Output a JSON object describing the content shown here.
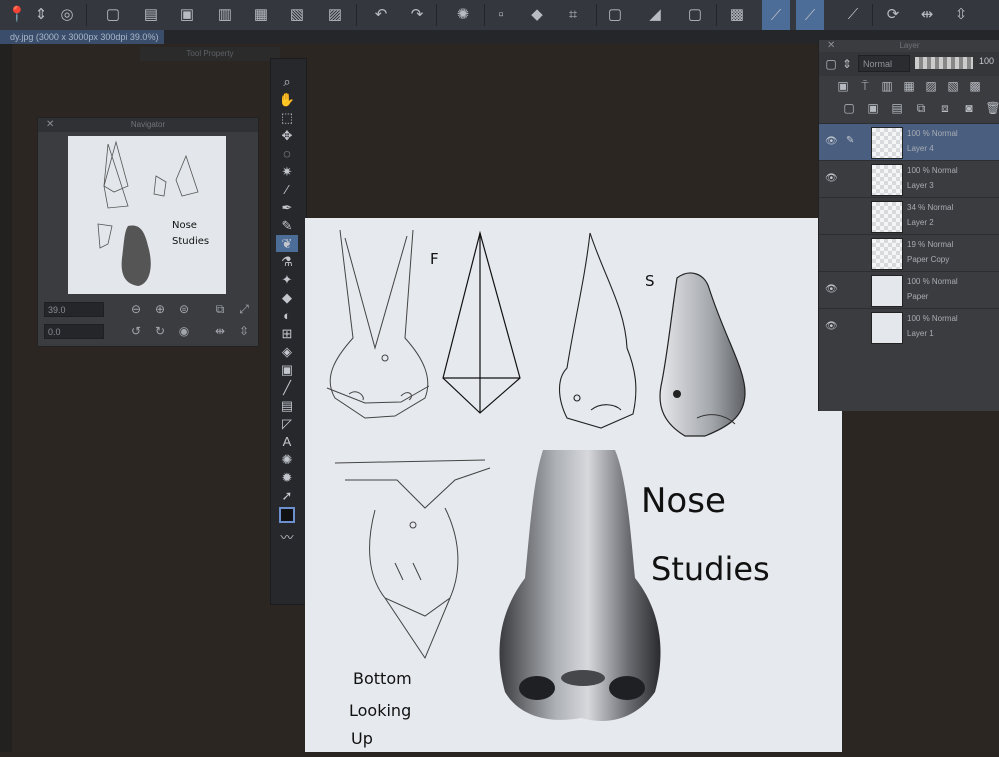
{
  "document": {
    "tab_label": "dy.jpg (3000 x 3000px 300dpi 39.0%)"
  },
  "toolbar": {
    "icons": [
      "pin-icon",
      "updown-icon",
      "app-icon",
      "new-file-icon",
      "open-folder-icon",
      "save-icon",
      "save-as-icon",
      "export-icon",
      "print-icon",
      "undo-icon",
      "redo-icon",
      "loading-icon",
      "fill-icon",
      "crop-icon",
      "clear-icon",
      "tone-icon",
      "transparency-icon",
      "grid-icon",
      "ruler-snap-icon",
      "line-snap-icon",
      "ruler-icon",
      "rotate-icon",
      "flip-horizontal-icon",
      "flip-vertical-icon"
    ]
  },
  "navigator": {
    "title": "Navigator",
    "zoom_value": "39.0",
    "rotation_value": "0.0"
  },
  "tool_property": {
    "title": "Tool Property"
  },
  "layer_panel": {
    "title": "Layer",
    "blend_mode": "Normal",
    "opacity": "100",
    "layers": [
      {
        "mode": "100 % Normal",
        "name": "Layer 4",
        "active": true,
        "visible": true
      },
      {
        "mode": "100 % Normal",
        "name": "Layer 3",
        "active": false,
        "visible": true
      },
      {
        "mode": "34 % Normal",
        "name": "Layer 2",
        "active": false,
        "visible": false
      },
      {
        "mode": "19 % Normal",
        "name": "Paper Copy",
        "active": false,
        "visible": false
      },
      {
        "mode": "100 % Normal",
        "name": "Paper",
        "active": false,
        "visible": true
      },
      {
        "mode": "100 % Normal",
        "name": "Layer 1",
        "active": false,
        "visible": true
      }
    ]
  },
  "canvas": {
    "label_front": "F",
    "label_side": "S",
    "title_line1": "Nose",
    "title_line2": "Studies",
    "bottom_line1": "Bottom",
    "bottom_line2": "Looking",
    "bottom_line3": "Up"
  },
  "colors": {
    "accent": "#4d6d99",
    "canvas": "#e6e9ee",
    "panel": "#3a3c40"
  }
}
